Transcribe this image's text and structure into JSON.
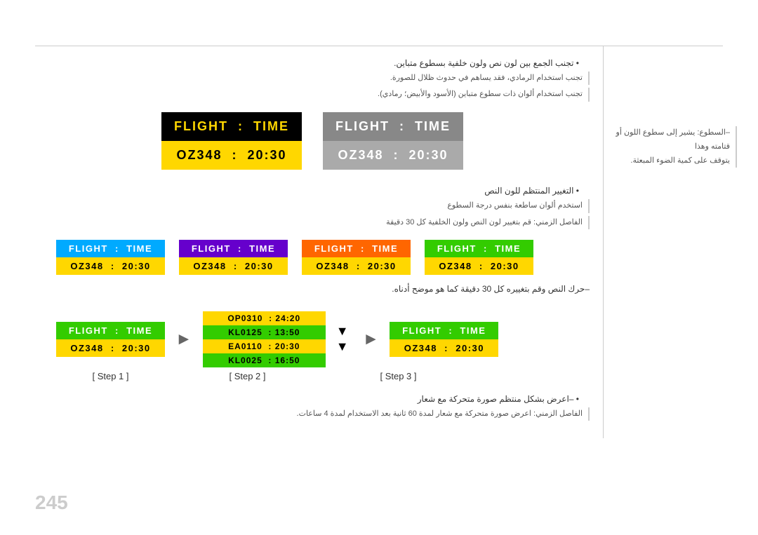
{
  "page": {
    "number": "245",
    "top_bullet1": "تجنب الجمع بين لون نص ولون خلفية بسطوع متباين.",
    "dash1": "تجنب استخدام الرمادي، فقد يساهم في حدوث ظلال للصورة.",
    "dash2": "تجنب استخدام ألوان ذات سطوع متباين (الأسود والأبيض؛ رمادي).",
    "top_bullet2": "التغيير المنتظم للون النص",
    "dash3": "استخدم ألوان ساطعة بنفس درجة السطوع",
    "dash4": "الفاصل الزمني: قم بتغيير لون النص ولون الخلفية كل 30 دقيقة",
    "arabic_scroll": "–حرك النص وقم بتغييره كل 30 دقيقة كما هو موضح أدناه.",
    "arabic_display": "–اعرض بشكل منتظم صورة متحركة مع شعار",
    "arabic_display2": "الفاصل الزمني: اعرض صورة متحركة مع شعار لمدة 60 ثانية بعد الاستخدام لمدة 4 ساعات.",
    "right_note1": "–السطوع: يشير إلى سطوع اللون أو قتامته وهذا",
    "right_note2": "يتوقف على كمية الضوء المبعثة.",
    "flight_label": "FLIGHT",
    "time_label": "TIME",
    "code": "OZ348",
    "time_value": "20:30",
    "colon": ":",
    "step1_label": "[ Step 1 ]",
    "step2_label": "[ Step 2 ]",
    "step3_label": "[ Step 3 ]",
    "middle_flights": [
      {
        "code": "OP0310",
        "time": "24:20"
      },
      {
        "code": "KL0125",
        "time": "13:50"
      },
      {
        "code": "EA0110",
        "time": "20:30"
      },
      {
        "code": "KL0025",
        "time": "16:50"
      }
    ]
  }
}
